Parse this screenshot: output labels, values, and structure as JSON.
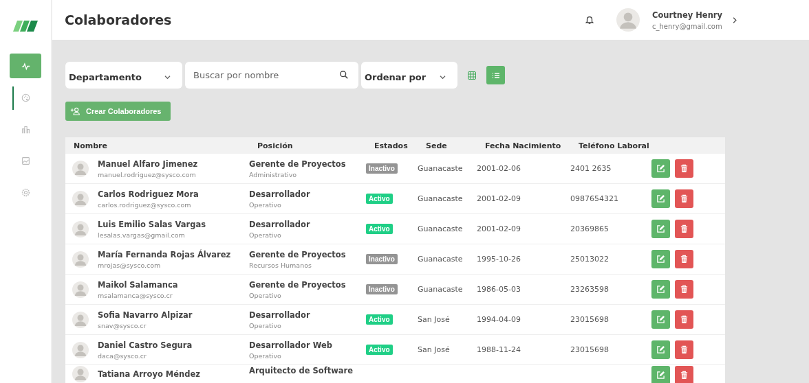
{
  "sidebar": {
    "items": [
      {
        "selected": true,
        "indicator": false
      },
      {
        "selected": false,
        "indicator": true
      },
      {
        "selected": false,
        "indicator": false
      },
      {
        "selected": false,
        "indicator": false
      },
      {
        "selected": false,
        "indicator": false
      }
    ]
  },
  "header": {
    "title": "Colaboradores",
    "user": {
      "name": "Courtney Henry",
      "email": "c_henry@gmail.com"
    }
  },
  "filters": {
    "department": "Departamento",
    "search": {
      "placeholder": "Buscar por nombre"
    },
    "sort": "Ordenar por",
    "views": [
      {
        "kind": "grid",
        "selected": false
      },
      {
        "kind": "list",
        "selected": true
      }
    ]
  },
  "create_button": "Crear Colaboradores",
  "table": {
    "columns": [
      "Nombre",
      "Posición",
      "Estados",
      "Sede",
      "Fecha Nacimiento",
      "Teléfono Laboral"
    ],
    "rows": [
      {
        "name": "Manuel Alfaro Jimenez",
        "email": "manuel.rodriguez@sysco.com",
        "position": "Gerente de Proyectos",
        "area": "Administrativo",
        "status": "Inactivo",
        "active": false,
        "site": "Guanacaste",
        "birth": "2001-02-06",
        "phone": "2401 2635"
      },
      {
        "name": "Carlos Rodriguez Mora",
        "email": "carlos.rodriguez@sysco.com",
        "position": "Desarrollador",
        "area": "Operativo",
        "status": "Activo",
        "active": true,
        "site": "Guanacaste",
        "birth": "2001-02-09",
        "phone": "0987654321"
      },
      {
        "name": "Luis Emilio Salas Vargas",
        "email": "lesalas.vargas@gmail.com",
        "position": "Desarrollador",
        "area": "Operativo",
        "status": "Activo",
        "active": true,
        "site": "Guanacaste",
        "birth": "2001-02-09",
        "phone": "20369865"
      },
      {
        "name": "María Fernanda Rojas Álvarez",
        "email": "mrojas@sysco.com",
        "position": "Gerente de Proyectos",
        "area": "Recursos Humanos",
        "status": "Inactivo",
        "active": false,
        "site": "Guanacaste",
        "birth": "1995-10-26",
        "phone": "25013022"
      },
      {
        "name": "Maikol Salamanca",
        "email": "msalamanca@sysco.cr",
        "position": "Gerente de Proyectos",
        "area": "Operativo",
        "status": "Inactivo",
        "active": false,
        "site": "Guanacaste",
        "birth": "1986-05-03",
        "phone": "23263598"
      },
      {
        "name": "Sofia Navarro Alpizar",
        "email": "snav@sysco.cr",
        "position": "Desarrollador",
        "area": "Operativo",
        "status": "Activo",
        "active": true,
        "site": "San José",
        "birth": "1994-04-09",
        "phone": "23015698"
      },
      {
        "name": "Daniel Castro Segura",
        "email": "daca@sysco.cr",
        "position": "Desarrollador Web",
        "area": "Operativo",
        "status": "Activo",
        "active": true,
        "site": "San José",
        "birth": "1988-11-24",
        "phone": "23015698"
      },
      {
        "name": "Tatiana Arroyo Méndez",
        "position": "Arquitecto de Software"
      }
    ]
  }
}
